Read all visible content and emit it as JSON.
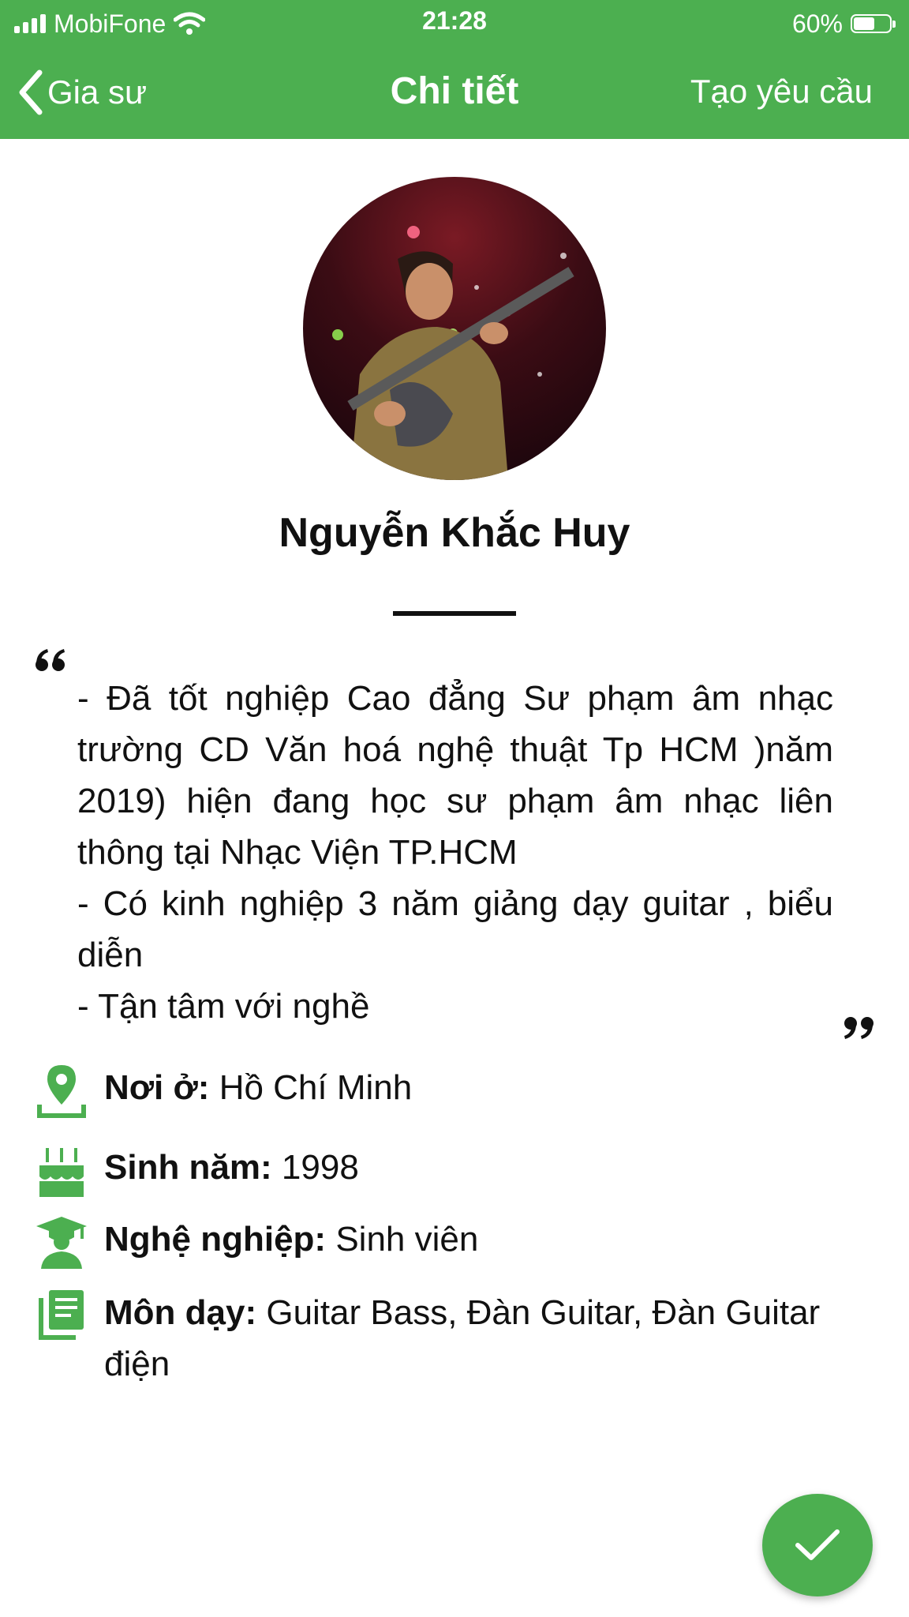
{
  "status_bar": {
    "carrier": "MobiFone",
    "time": "21:28",
    "battery": "60%",
    "battery_level": 0.6
  },
  "nav": {
    "back_label": "Gia sư",
    "title": "Chi tiết",
    "action_label": "Tạo yêu cầu"
  },
  "profile": {
    "name": "Nguyễn Khắc Huy",
    "bio_lines": [
      "- Đã tốt nghiệp Cao đẳng Sư phạm âm nhạc trường CD Văn hoá nghệ thuật Tp HCM )năm 2019) hiện đang học sư phạm âm nhạc liên thông tại Nhạc Viện TP.HCM",
      "- Có kinh nghiệp 3 năm giảng dạy guitar , biểu diễn",
      "- Tận tâm với nghề"
    ]
  },
  "details": [
    {
      "icon": "location-pin-icon",
      "label": "Nơi ở:",
      "value": "Hồ Chí Minh"
    },
    {
      "icon": "birthday-cake-icon",
      "label": "Sinh năm:",
      "value": "1998"
    },
    {
      "icon": "graduate-icon",
      "label": "Nghệ nghiệp:",
      "value": "Sinh viên"
    },
    {
      "icon": "book-icon",
      "label": "Môn dạy:",
      "value": "Guitar Bass, Đàn Guitar, Đàn Guitar điện"
    }
  ],
  "colors": {
    "accent": "#4caf50",
    "text": "#111111",
    "white": "#ffffff"
  }
}
